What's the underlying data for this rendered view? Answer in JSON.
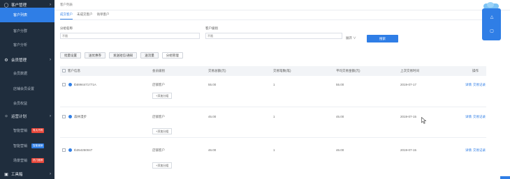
{
  "sidebar": {
    "group_customer": "客户管理",
    "item_customer_list": "客户列表",
    "item_customer_segment": "客户分群",
    "item_customer_analysis": "客户分析",
    "group_member": "会员管理",
    "item_member_data": "会员数据",
    "item_member_benefits": "店铺会员设置",
    "item_member_rights": "会员权益",
    "group_ops": "运营计划",
    "item_smart_plan": "智能营销",
    "badge_smart_plan": "有大不同",
    "item_auto_campaign": "智能营销",
    "badge_auto_campaign": "智能营销",
    "item_strategy": "场景营销",
    "badge_strategy": "热门推荐",
    "group_tools": "工具箱"
  },
  "main": {
    "breadcrumb": "客户列表",
    "tabs": [
      "成交客户",
      "未成交客户",
      "询单客户"
    ],
    "filter_group_label": "分组名称",
    "filter_group_placeholder": "不限",
    "filter_level_label": "客户级别",
    "filter_level_placeholder": "不限",
    "more_label": "展开",
    "search_label": "搜索",
    "buttons": [
      "批量设置",
      "送优惠券",
      "发送短信/通知",
      "送流量",
      "分组管理"
    ],
    "columns": [
      "客户信息",
      "会员级别",
      "交易总额(元)",
      "交易笔数(笔)",
      "平均交易金额(元)",
      "上次交易时间",
      "操作"
    ],
    "add_group_label": "+添加分组",
    "action_detail": "详情",
    "action_trade": "交易记录",
    "rows": [
      {
        "name": "tb5994471771A",
        "level": "店铺客户",
        "total": "55.00",
        "count": "1",
        "avg": "55.00",
        "last": "2019-07-17"
      },
      {
        "name": "森林漫步",
        "level": "店铺客户",
        "total": "45.00",
        "count": "1",
        "avg": "45.00",
        "last": "2019-07-15"
      },
      {
        "name": "tb354250047",
        "level": "店铺客户",
        "total": "46.00",
        "count": "1",
        "avg": "46.00",
        "last": "2019-07-15"
      }
    ]
  }
}
